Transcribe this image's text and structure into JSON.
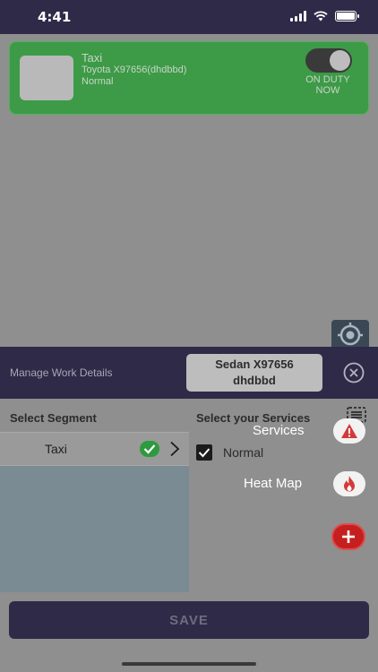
{
  "status_bar": {
    "time": "4:41"
  },
  "vehicle_card": {
    "name": "Taxi",
    "model": "Toyota X97656(dhdbbd)",
    "type": "Normal",
    "duty_label": "ON DUTY NOW",
    "duty_on": true
  },
  "work_bar": {
    "title": "Manage Work Details",
    "vehicle_line1": "Sedan X97656",
    "vehicle_line2": "dhdbbd"
  },
  "segment_panel": {
    "title": "Select Segment",
    "items": [
      {
        "label": "Taxi",
        "selected": true
      }
    ]
  },
  "services_panel": {
    "title": "Select your Services",
    "items": [
      {
        "label": "Normal",
        "checked": true
      }
    ]
  },
  "fab_menu": {
    "services_label": "Services",
    "heatmap_label": "Heat Map"
  },
  "footer": {
    "save_label": "SAVE"
  },
  "colors": {
    "header": "#2f2a48",
    "duty_green": "#3d9a47",
    "check_green": "#2e9a3f",
    "fab_red": "#c42020"
  },
  "icons": [
    "wifi-icon",
    "battery-icon",
    "locate-icon",
    "close-icon",
    "check-icon",
    "chevron-right-icon",
    "list-icon",
    "warning-icon",
    "fire-icon",
    "plus-icon"
  ]
}
